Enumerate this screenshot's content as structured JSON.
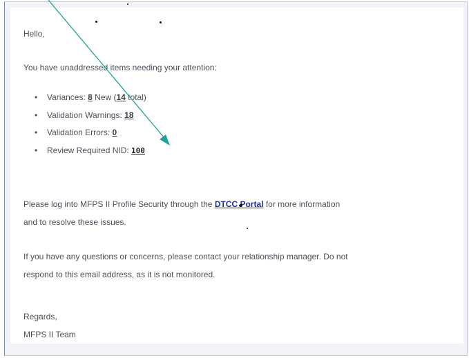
{
  "email": {
    "greeting": "Hello,",
    "intro": "You have unaddressed items needing your attention:",
    "items": [
      {
        "label": "Variances: ",
        "value": "8",
        "suffix_a": " New (",
        "value2": "14",
        "suffix_b": " total)"
      },
      {
        "label": "Validation Warnings: ",
        "value": "18"
      },
      {
        "label": "Validation Errors: ",
        "value": "0"
      },
      {
        "label": "Review Required NID: ",
        "value": "100"
      }
    ],
    "paragraph1_before_link": "Please log into MFPS II Profile Security through the ",
    "link_text": "DTCC Portal",
    "paragraph1_after_link": " for more information",
    "paragraph1_line2": "and to resolve these issues.",
    "paragraph2_line1": "If you have any questions or concerns, please contact your relationship manager. Do not",
    "paragraph2_line2": "respond to this email address, as it is not monitored.",
    "sign_off": "Regards,",
    "signature": "MFPS II Team"
  },
  "colors": {
    "text": "#4a4f59",
    "link": "#1c2fa8",
    "arrow": "#1aa39a"
  }
}
